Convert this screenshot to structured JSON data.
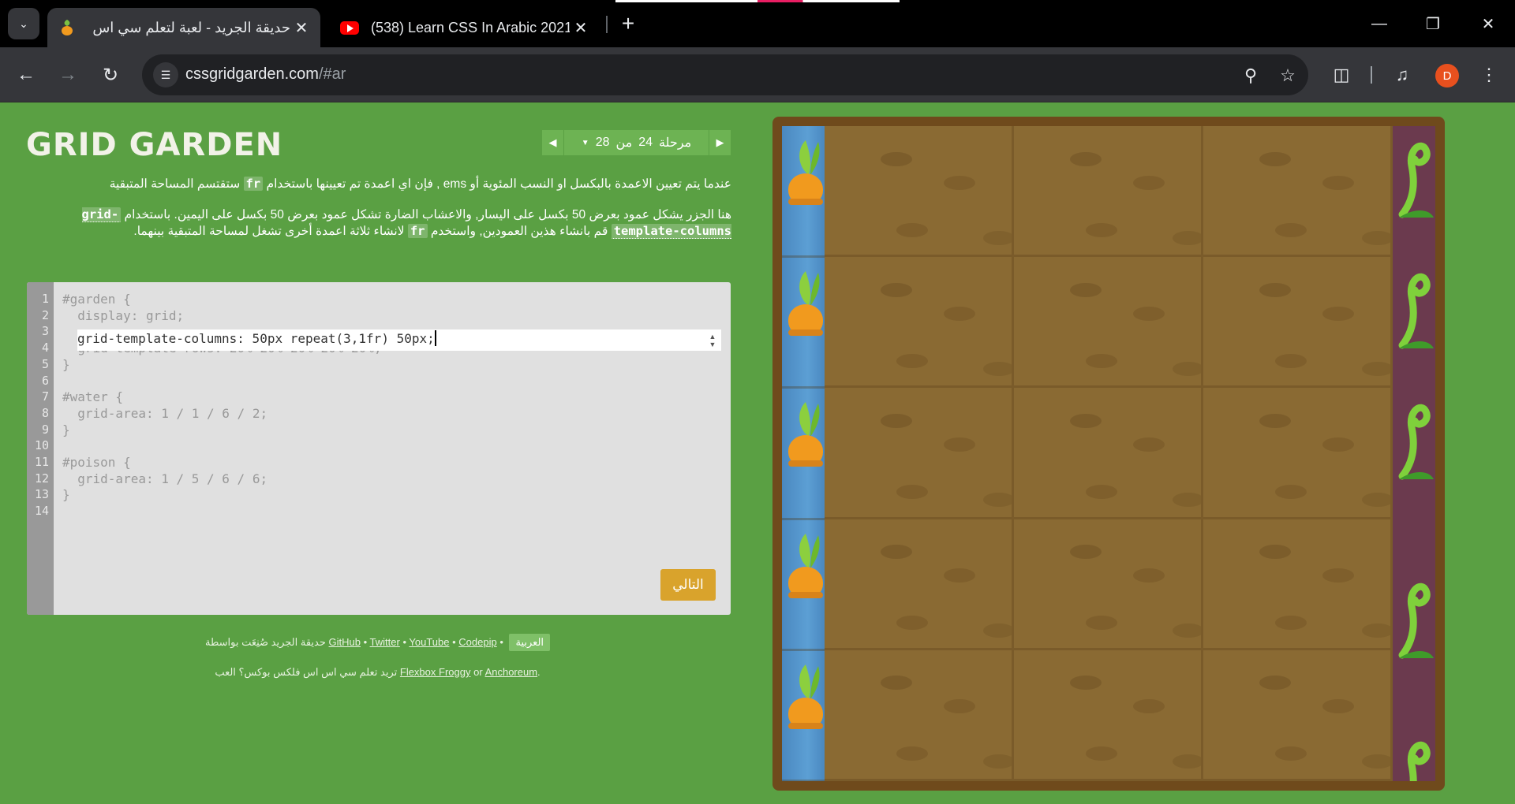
{
  "browser": {
    "tabs": [
      {
        "title": "حديقة الجريد - لعبة لتعلم سي اس",
        "favicon": "carrot-icon",
        "active": true
      },
      {
        "title": "(538) Learn CSS In Arabic 2021",
        "favicon": "youtube-icon",
        "active": false
      }
    ],
    "url_host": "cssgridgarden.com",
    "url_path": "/#ar",
    "profile_initial": "D"
  },
  "game": {
    "logo": "GRID GARDEN",
    "level": {
      "label": "مرحلة",
      "current": "24",
      "of": "من",
      "total": "28"
    },
    "instructions": {
      "p1_before": "عندما يتم تعيين الاعمدة بالبكسل او النسب المئوية أو ems , فإن اي اعمدة تم تعيينها باستخدام ",
      "p1_code": "fr",
      "p1_after": " ستقتسم المساحة المتبقية",
      "p2_a": "هنا الجزر يشكل عمود بعرض 50 بكسل على اليسار, والاعشاب الضارة تشكل عمود بعرض 50 بكسل على اليمين. باستخدام ",
      "p2_code1": "grid-template-columns",
      "p2_b": " قم بانشاء هذين العمودين, واستخدم ",
      "p2_code2": "fr",
      "p2_c": " لانشاء ثلاثة اعمدة أخرى تشغل لمساحة المتبقية بينهما."
    },
    "editor": {
      "line_numbers": [
        "1",
        "2",
        "3",
        "4",
        "5",
        "6",
        "7",
        "8",
        "9",
        "10",
        "11",
        "12",
        "13",
        "14"
      ],
      "lines": [
        "#garden {",
        "  display: grid;",
        "",
        "  grid-template-rows: 20% 20% 20% 20% 20%;",
        "}",
        "",
        "#water {",
        "  grid-area: 1 / 1 / 6 / 2;",
        "}",
        "",
        "#poison {",
        "  grid-area: 1 / 5 / 6 / 6;",
        "}",
        ""
      ],
      "input_value": "grid-template-columns: 50px repeat(3,1fr) 50px;"
    },
    "next_button": "التالي",
    "credits": {
      "lang": "العربية",
      "github": "GitHub",
      "twitter": "Twitter",
      "youtube": "YouTube",
      "codepip": "Codepip",
      "made_by": "حديقة الجريد صُنِعَت بواسطة",
      "want_more": "تريد تعلم سي اس اس فلكس بوكس؟ العب",
      "froggy": "Flexbox Froggy",
      "or": "or",
      "anchoreum": "Anchoreum"
    },
    "board": {
      "rows": 5,
      "water_color": "#4a88c0",
      "poison_color": "#6b3a4e",
      "soil_color": "#8a6a33"
    }
  }
}
